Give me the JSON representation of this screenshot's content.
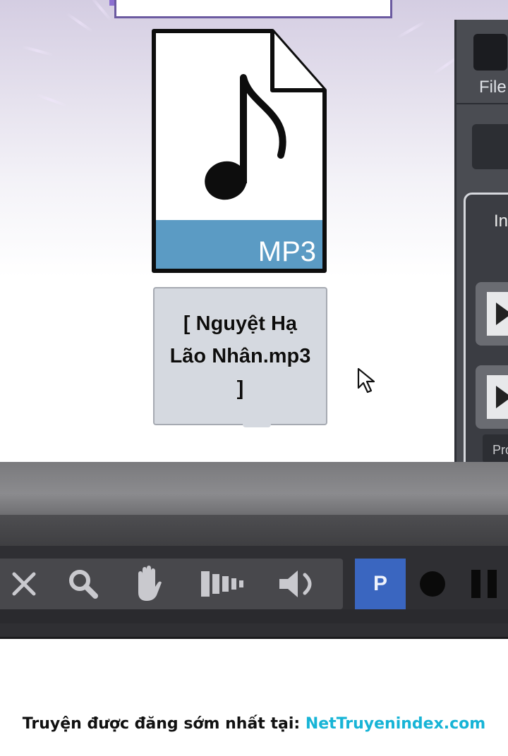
{
  "file_icon": {
    "format_label": "MP3",
    "band_color": "#5b9bc4",
    "icon": "music-note-icon"
  },
  "file_label": {
    "name": "[ Nguyệt Hạ Lão Nhân.mp3 ]"
  },
  "side_window": {
    "menu_file": "File",
    "panel_title": "In",
    "bottom_button": "Pro"
  },
  "toolbar": {
    "tools": [
      "close-icon",
      "search-icon",
      "hand-icon",
      "volume-bars-icon",
      "speaker-icon"
    ],
    "p_button": "P",
    "p_button_color": "#3a66c0",
    "record_icon": "record-icon",
    "pause_icon": "pause-icon"
  },
  "footer": {
    "text": "Truyện được đăng sớm nhất tại: ",
    "link": "NetTruyenindex.com",
    "link_color": "#17b4d6"
  }
}
